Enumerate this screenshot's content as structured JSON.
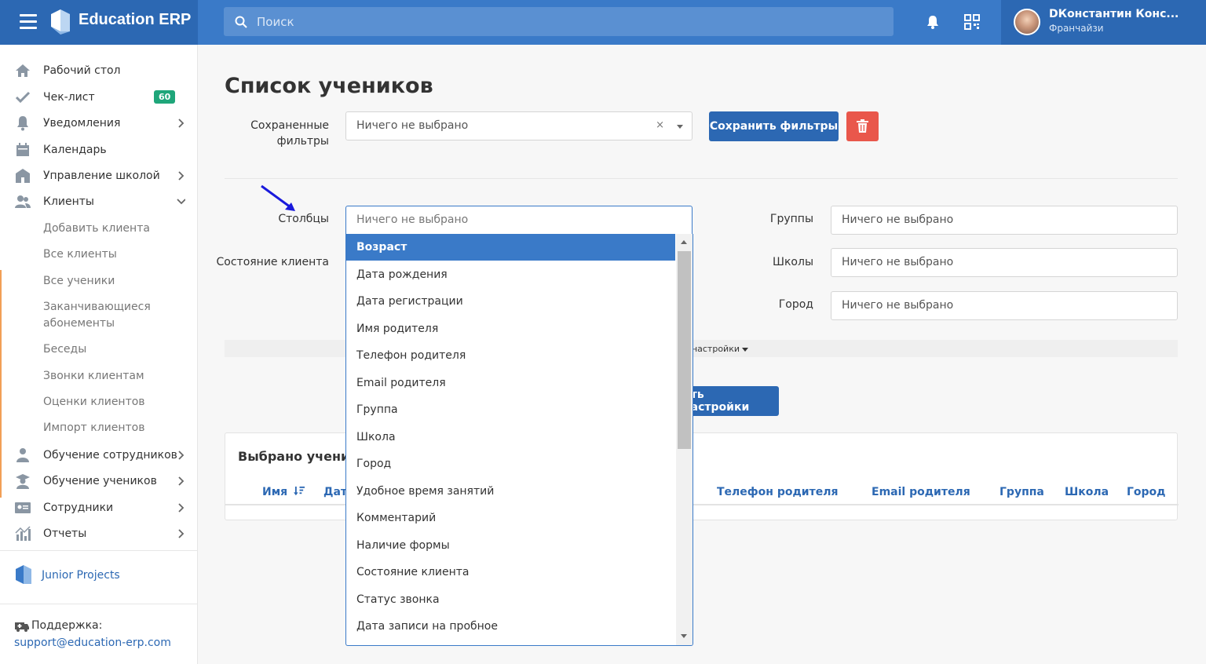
{
  "app": {
    "brand": "Education ERP"
  },
  "search": {
    "placeholder": "Поиск"
  },
  "user": {
    "name": "DКонстантин Конс...",
    "role": "Франчайзи"
  },
  "sidebar": {
    "items": [
      {
        "label": "Рабочий стол",
        "icon": "home-icon"
      },
      {
        "label": "Чек-лист",
        "icon": "check-icon",
        "badge": "60"
      },
      {
        "label": "Уведомления",
        "icon": "bell-icon"
      },
      {
        "label": "Календарь",
        "icon": "calendar-icon"
      },
      {
        "label": "Управление школой",
        "icon": "school-icon"
      },
      {
        "label": "Клиенты",
        "icon": "users-icon"
      }
    ],
    "client_sub": [
      "Добавить клиента",
      "Все клиенты",
      "Все ученики",
      "Заканчивающиеся абонементы",
      "Беседы",
      "Звонки клиентам",
      "Оценки клиентов",
      "Импорт клиентов"
    ],
    "items2": [
      {
        "label": "Обучение сотрудников",
        "icon": "staff-training-icon"
      },
      {
        "label": "Обучение учеников",
        "icon": "student-training-icon"
      },
      {
        "label": "Сотрудники",
        "icon": "id-card-icon"
      },
      {
        "label": "Отчеты",
        "icon": "chart-icon"
      }
    ],
    "org": "Junior Projects",
    "support_label": "Поддержка:",
    "support_email": "support@education-erp.com"
  },
  "page": {
    "title": "Список учеников",
    "saved_filters_label_1": "Сохраненные",
    "saved_filters_label_2": "фильтры",
    "saved_filters_value": "Ничего не выбрано",
    "save_filters_btn": "Сохранить фильтры",
    "columns_label": "Столбцы",
    "columns_placeholder": "Ничего не выбрано",
    "client_state_label": "Состояние клиента",
    "groups_label": "Группы",
    "groups_placeholder": "Ничего не выбрано",
    "schools_label": "Школы",
    "schools_placeholder": "Ничего не выбрано",
    "city_label": "Город",
    "city_placeholder": "Ничего не выбрано",
    "advanced_link": "ые настройки",
    "apply_btn": "ить настройки"
  },
  "table": {
    "title": "Выбрано ученико",
    "headers": [
      "Имя",
      "Дата",
      "Телефон родителя",
      "Email родителя",
      "Группа",
      "Школа",
      "Город"
    ]
  },
  "dropdown": {
    "selected_index": 0,
    "options": [
      "Возраст",
      "Дата рождения",
      "Дата регистрации",
      "Имя родителя",
      "Телефон родителя",
      "Email родителя",
      "Группа",
      "Школа",
      "Город",
      "Удобное время занятий",
      "Комментарий",
      "Наличие формы",
      "Состояние клиента",
      "Статус звонка",
      "Дата записи на пробное"
    ]
  },
  "colors": {
    "primary": "#2c68b3",
    "topbar": "#3a7ac8",
    "danger": "#e9574b",
    "badge": "#1fa67a"
  }
}
